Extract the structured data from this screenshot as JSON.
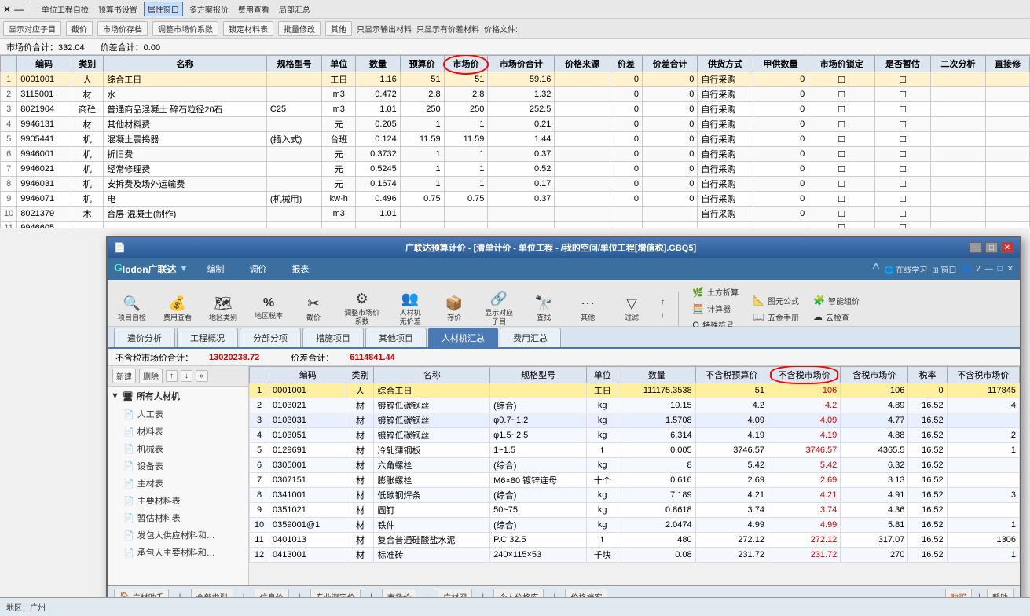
{
  "bgWindow": {
    "title": "属性窗口",
    "toolbar1": {
      "items": [
        "单位工程自检",
        "预算书设置",
        "属性窗口",
        "多方案报价",
        "费用查看",
        "局部汇总"
      ]
    },
    "toolbar2": {
      "items": [
        "显示对应子目",
        "截价",
        "市场价存档",
        "调整市场价系数",
        "锁定材料表",
        "批量修改",
        "其他",
        "只显示输出材料",
        "只显示有价差材料",
        "价格文件:"
      ]
    },
    "summaryBar": {
      "marketTotal": "市场价合计：332.04",
      "diffTotal": "价差合计：0.00"
    },
    "tableHeaders": [
      "编码",
      "类别",
      "名称",
      "规格型号",
      "单位",
      "数量",
      "预算价",
      "市场价",
      "市场价合计",
      "价格来源",
      "价差",
      "价差合计",
      "供货方式",
      "甲供数量",
      "市场价锁定",
      "是否暂估",
      "二次分析",
      "直接修"
    ],
    "tableRows": [
      {
        "num": "1",
        "code": "0001001",
        "type": "人",
        "name": "综合工日",
        "spec": "",
        "unit": "工日",
        "qty": "1.16",
        "budgetPrice": "51",
        "marketPrice": "51",
        "marketTotal": "59.16",
        "priceSource": "",
        "diff": "0",
        "diffTotal": "0",
        "supply": "自行采购",
        "jgQty": "0",
        "locked": false,
        "estimate": false,
        "isHighlight": true
      },
      {
        "num": "2",
        "code": "3115001",
        "type": "材",
        "name": "水",
        "spec": "",
        "unit": "m3",
        "qty": "0.472",
        "budgetPrice": "2.8",
        "marketPrice": "2.8",
        "marketTotal": "1.32",
        "priceSource": "",
        "diff": "0",
        "diffTotal": "0",
        "supply": "自行采购",
        "jgQty": "0",
        "locked": false,
        "estimate": false
      },
      {
        "num": "3",
        "code": "8021904",
        "type": "商砼",
        "name": "普通商品混凝土 碎石粒径20石",
        "spec": "C25",
        "unit": "m3",
        "qty": "1.01",
        "budgetPrice": "250",
        "marketPrice": "250",
        "marketTotal": "252.5",
        "priceSource": "",
        "diff": "0",
        "diffTotal": "0",
        "supply": "自行采购",
        "jgQty": "0",
        "locked": false,
        "estimate": false
      },
      {
        "num": "4",
        "code": "9946131",
        "type": "材",
        "name": "其他材料费",
        "spec": "",
        "unit": "元",
        "qty": "0.205",
        "budgetPrice": "1",
        "marketPrice": "1",
        "marketTotal": "0.21",
        "priceSource": "",
        "diff": "0",
        "diffTotal": "0",
        "supply": "自行采购",
        "jgQty": "0",
        "locked": false,
        "estimate": false
      },
      {
        "num": "5",
        "code": "9905441",
        "type": "机",
        "name": "混凝土震捣器",
        "spec": "(插入式)",
        "unit": "台班",
        "qty": "0.124",
        "budgetPrice": "11.59",
        "marketPrice": "11.59",
        "marketTotal": "1.44",
        "priceSource": "",
        "diff": "0",
        "diffTotal": "0",
        "supply": "自行采购",
        "jgQty": "0",
        "locked": false,
        "estimate": false
      },
      {
        "num": "6",
        "code": "9946001",
        "type": "机",
        "name": "折旧费",
        "spec": "",
        "unit": "元",
        "qty": "0.3732",
        "budgetPrice": "1",
        "marketPrice": "1",
        "marketTotal": "0.37",
        "priceSource": "",
        "diff": "0",
        "diffTotal": "0",
        "supply": "自行采购",
        "jgQty": "0",
        "locked": false,
        "estimate": false
      },
      {
        "num": "7",
        "code": "9946021",
        "type": "机",
        "name": "经常修理费",
        "spec": "",
        "unit": "元",
        "qty": "0.5245",
        "budgetPrice": "1",
        "marketPrice": "1",
        "marketTotal": "0.52",
        "priceSource": "",
        "diff": "0",
        "diffTotal": "0",
        "supply": "自行采购",
        "jgQty": "0",
        "locked": false,
        "estimate": false
      },
      {
        "num": "8",
        "code": "9946031",
        "type": "机",
        "name": "安拆费及场外运输费",
        "spec": "",
        "unit": "元",
        "qty": "0.1674",
        "budgetPrice": "1",
        "marketPrice": "1",
        "marketTotal": "0.17",
        "priceSource": "",
        "diff": "0",
        "diffTotal": "0",
        "supply": "自行采购",
        "jgQty": "0",
        "locked": false,
        "estimate": false
      },
      {
        "num": "9",
        "code": "9946071",
        "type": "机",
        "name": "电",
        "spec": "(机械用)",
        "unit": "kw·h",
        "qty": "0.496",
        "budgetPrice": "0.75",
        "marketPrice": "0.75",
        "marketTotal": "0.37",
        "priceSource": "",
        "diff": "0",
        "diffTotal": "0",
        "supply": "自行采购",
        "jgQty": "0",
        "locked": false,
        "estimate": false
      },
      {
        "num": "10",
        "code": "8021379",
        "type": "木",
        "name": "合层·混凝土(制作)",
        "spec": "",
        "unit": "m3",
        "qty": "1.01",
        "budgetPrice": "",
        "marketPrice": "",
        "marketTotal": "",
        "priceSource": "",
        "diff": "",
        "diffTotal": "",
        "supply": "自行采购",
        "jgQty": "0",
        "locked": false,
        "estimate": false
      },
      {
        "num": "11",
        "code": "9946605",
        "type": "",
        "name": "",
        "spec": "",
        "unit": "",
        "qty": "",
        "budgetPrice": "",
        "marketPrice": "",
        "marketTotal": "",
        "priceSource": "",
        "diff": "",
        "diffTotal": "",
        "supply": "",
        "jgQty": "",
        "locked": false,
        "estimate": false
      }
    ]
  },
  "floatWindow": {
    "title": "广联达预算计价 - [清单计价 - 单位工程 - /我的空间/单位工程[增值税].GBQ5]",
    "logo": "Glodon广联达 ▼",
    "menus": [
      "编制",
      "调价",
      "报表"
    ],
    "rightMenus": [
      "在线学习",
      "窗口",
      "👤",
      "?",
      "—",
      "□",
      "✕"
    ],
    "toolbar": {
      "buttons": [
        {
          "icon": "🔍",
          "label": "项目自检"
        },
        {
          "icon": "💰",
          "label": "费用查看"
        },
        {
          "icon": "🗺",
          "label": "地区类别"
        },
        {
          "icon": "%",
          "label": "地区税率"
        },
        {
          "icon": "✂",
          "label": "截价"
        },
        {
          "icon": "⚙",
          "label": "调整市场价\n系数"
        },
        {
          "icon": "👥",
          "label": "人材机\n无价差"
        },
        {
          "icon": "📦",
          "label": "存价"
        },
        {
          "icon": "🔗",
          "label": "显示对应\n子目"
        },
        {
          "icon": "🔍",
          "label": "查找"
        },
        {
          "icon": "⋯",
          "label": "其他"
        },
        {
          "icon": "▽",
          "label": "过滤"
        },
        {
          "icon": "↑",
          "label": ""
        },
        {
          "icon": "↓",
          "label": ""
        },
        {
          "icon": "🌿",
          "label": "土方折算"
        },
        {
          "icon": "📐",
          "label": "图元公式"
        },
        {
          "icon": "🧮",
          "label": "计算器"
        },
        {
          "icon": "📖",
          "label": "五金手册"
        },
        {
          "icon": "🧩",
          "label": "智能组价"
        },
        {
          "icon": "☁",
          "label": "云检查"
        },
        {
          "icon": "Ω",
          "label": "特殊符号"
        }
      ]
    },
    "tabs": [
      {
        "label": "造价分析",
        "active": false
      },
      {
        "label": "工程概况",
        "active": false
      },
      {
        "label": "分部分项",
        "active": false
      },
      {
        "label": "措施项目",
        "active": false
      },
      {
        "label": "其他项目",
        "active": false
      },
      {
        "label": "人材机汇总",
        "active": true
      },
      {
        "label": "费用汇总",
        "active": false
      }
    ],
    "summaryBar": {
      "label1": "不含税市场价合计：",
      "value1": "13020238.72",
      "label2": "价差合计：",
      "value2": "6114841.44"
    },
    "sidebar": {
      "toolbarBtns": [
        "新建",
        "删除",
        "↑",
        "↓",
        "«"
      ],
      "rootItem": "所有人材机",
      "children": [
        {
          "label": "人工表",
          "icon": "📋"
        },
        {
          "label": "材料表",
          "icon": "📋"
        },
        {
          "label": "机械表",
          "icon": "📋"
        },
        {
          "label": "设备表",
          "icon": "📋"
        },
        {
          "label": "主材表",
          "icon": "📋"
        },
        {
          "label": "主要材料表",
          "icon": "📋"
        },
        {
          "label": "暂估材料表",
          "icon": "📋"
        },
        {
          "label": "发包人供应材料和…",
          "icon": "📋"
        },
        {
          "label": "承包人主要材料和…",
          "icon": "📋"
        }
      ]
    },
    "tableHeaders": [
      "",
      "编码",
      "类别",
      "名称",
      "规格型号",
      "单位",
      "数量",
      "不含税预算价",
      "不含税市场价",
      "含税市场价",
      "税率",
      "不含税市场价"
    ],
    "tableRows": [
      {
        "num": "1",
        "code": "0001001",
        "type": "人",
        "name": "综合工日",
        "spec": "",
        "unit": "工日",
        "qty": "111175.3538",
        "budgetPrice": "51",
        "marketPrice": "106",
        "taxMarket": "106",
        "taxRate": "0",
        "exMarket": "117845",
        "isHighlight": true
      },
      {
        "num": "2",
        "code": "0103021",
        "type": "材",
        "name": "镀锌低碳钢丝",
        "spec": "(综合)",
        "unit": "kg",
        "qty": "10.15",
        "budgetPrice": "4.2",
        "marketPrice": "4.2",
        "taxMarket": "4.89",
        "taxRate": "16.52",
        "exMarket": "4"
      },
      {
        "num": "3",
        "code": "0103031",
        "type": "材",
        "name": "镀锌低碳钢丝",
        "spec": "φ0.7~1.2",
        "unit": "kg",
        "qty": "1.5708",
        "budgetPrice": "4.09",
        "marketPrice": "4.09",
        "taxMarket": "4.77",
        "taxRate": "16.52",
        "exMarket": "",
        "isHighlight2": true
      },
      {
        "num": "4",
        "code": "0103051",
        "type": "材",
        "name": "镀锌低碳钢丝",
        "spec": "φ1.5~2.5",
        "unit": "kg",
        "qty": "6.314",
        "budgetPrice": "4.19",
        "marketPrice": "4.19",
        "taxMarket": "4.88",
        "taxRate": "16.52",
        "exMarket": "2"
      },
      {
        "num": "5",
        "code": "0129691",
        "type": "材",
        "name": "冷轧薄钢板",
        "spec": "1~1.5",
        "unit": "t",
        "qty": "0.005",
        "budgetPrice": "3746.57",
        "marketPrice": "3746.57",
        "taxMarket": "4365.5",
        "taxRate": "16.52",
        "exMarket": "1"
      },
      {
        "num": "6",
        "code": "0305001",
        "type": "材",
        "name": "六角螺栓",
        "spec": "(综合)",
        "unit": "kg",
        "qty": "8",
        "budgetPrice": "5.42",
        "marketPrice": "5.42",
        "taxMarket": "6.32",
        "taxRate": "16.52",
        "exMarket": ""
      },
      {
        "num": "7",
        "code": "0307151",
        "type": "材",
        "name": "膨胀螺栓",
        "spec": "M6×80 镀锌连母",
        "unit": "十个",
        "qty": "0.616",
        "budgetPrice": "2.69",
        "marketPrice": "2.69",
        "taxMarket": "3.13",
        "taxRate": "16.52",
        "exMarket": ""
      },
      {
        "num": "8",
        "code": "0341001",
        "type": "材",
        "name": "低碳钢焊条",
        "spec": "(综合)",
        "unit": "kg",
        "qty": "7.189",
        "budgetPrice": "4.21",
        "marketPrice": "4.21",
        "taxMarket": "4.91",
        "taxRate": "16.52",
        "exMarket": "3"
      },
      {
        "num": "9",
        "code": "0351021",
        "type": "材",
        "name": "圆钉",
        "spec": "50~75",
        "unit": "kg",
        "qty": "0.8618",
        "budgetPrice": "3.74",
        "marketPrice": "3.74",
        "taxMarket": "4.36",
        "taxRate": "16.52",
        "exMarket": ""
      },
      {
        "num": "10",
        "code": "0359001@1",
        "type": "材",
        "name": "铁件",
        "spec": "(综合)",
        "unit": "kg",
        "qty": "2.0474",
        "budgetPrice": "4.99",
        "marketPrice": "4.99",
        "taxMarket": "5.81",
        "taxRate": "16.52",
        "exMarket": "1"
      },
      {
        "num": "11",
        "code": "0401013",
        "type": "材",
        "name": "复合普通硅酸盐水泥",
        "spec": "P.C 32.5",
        "unit": "t",
        "qty": "480",
        "budgetPrice": "272.12",
        "marketPrice": "272.12",
        "taxMarket": "317.07",
        "taxRate": "16.52",
        "exMarket": "1306"
      },
      {
        "num": "12",
        "code": "0413001",
        "type": "材",
        "name": "标准砖",
        "spec": "240×115×53",
        "unit": "千块",
        "qty": "0.08",
        "budgetPrice": "231.72",
        "marketPrice": "231.72",
        "taxMarket": "270",
        "taxRate": "16.52",
        "exMarket": "1"
      }
    ],
    "bottomBar": {
      "items": [
        "广材助手",
        "全部类型",
        "信息价",
        "专业测定价",
        "市场价",
        "广材网",
        "个人价格库",
        "价格档案"
      ]
    }
  },
  "statusBar": {
    "location": "地区：广州"
  }
}
